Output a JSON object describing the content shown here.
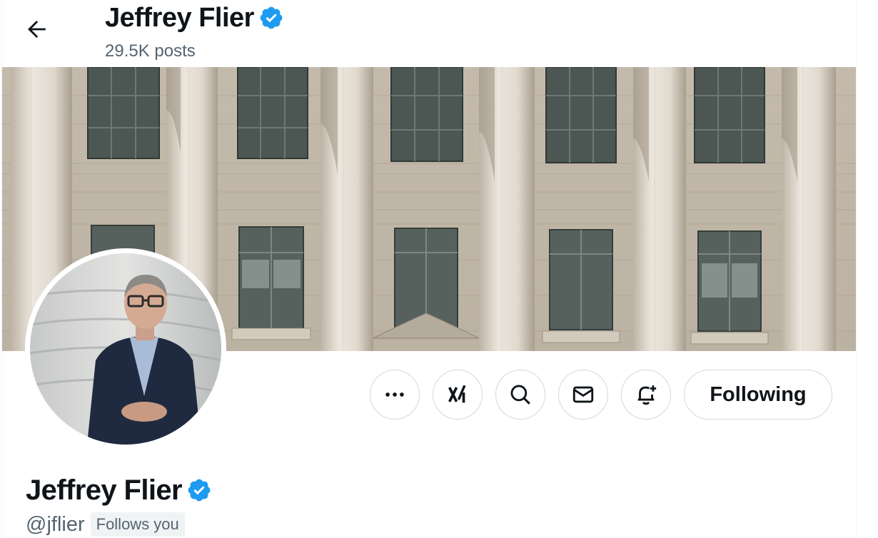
{
  "header": {
    "back_icon": "arrow-left-icon",
    "name": "Jeffrey Flier",
    "posts_count": "29.5K posts",
    "verified_icon": "verified-badge-icon"
  },
  "banner": {
    "description_icon": "banner-image"
  },
  "avatar": {
    "icon": "profile-photo"
  },
  "actions": {
    "more_icon": "more-horizontal-icon",
    "grok_icon": "grok-icon",
    "search_icon": "search-icon",
    "message_icon": "envelope-icon",
    "notify_icon": "bell-plus-icon",
    "following_label": "Following"
  },
  "profile": {
    "name": "Jeffrey Flier",
    "handle": "@jflier",
    "follows_you": "Follows you"
  },
  "colors": {
    "verified": "#1d9bf0",
    "text_primary": "#0f1419",
    "text_secondary": "#536471",
    "border": "#cfd9de"
  }
}
